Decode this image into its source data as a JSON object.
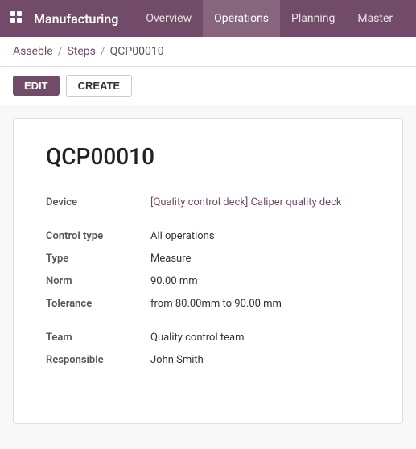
{
  "nav": {
    "app_icon": "grid-icon",
    "app_title": "Manufacturing",
    "menu_items": [
      {
        "label": "Overview",
        "active": false
      },
      {
        "label": "Operations",
        "active": true
      },
      {
        "label": "Planning",
        "active": false
      },
      {
        "label": "Master",
        "active": false
      }
    ]
  },
  "breadcrumb": {
    "parent": "Asseble",
    "middle": "Steps",
    "current": "QCP00010"
  },
  "actions": {
    "edit_label": "EDIT",
    "create_label": "CREATE"
  },
  "record": {
    "title": "QCP00010",
    "fields": {
      "device_label": "Device",
      "device_value": "[Quality control deck] Caliper quality deck",
      "control_type_label": "Control type",
      "control_type_value": "All operations",
      "type_label": "Type",
      "type_value": "Measure",
      "norm_label": "Norm",
      "norm_value": "90.00 mm",
      "tolerance_label": "Tolerance",
      "tolerance_value": "from 80.00mm to 90.00 mm",
      "team_label": "Team",
      "team_value": "Quality control team",
      "responsible_label": "Responsible",
      "responsible_value": "John Smith"
    }
  }
}
